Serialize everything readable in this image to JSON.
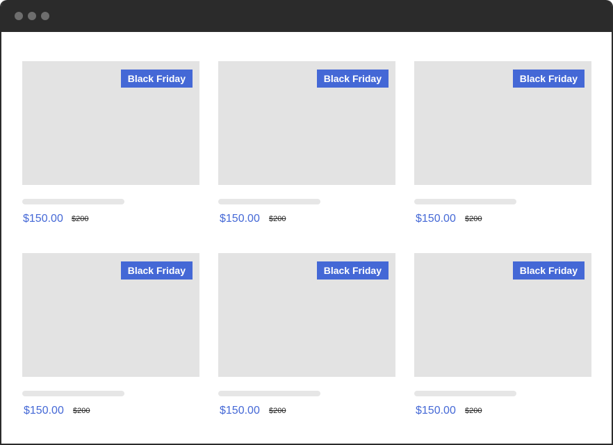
{
  "window": {
    "controls": [
      "close",
      "minimize",
      "maximize"
    ]
  },
  "accent_color": "#4468d6",
  "products": [
    {
      "badge": "Black Friday",
      "price": "$150.00",
      "old_price": "$200"
    },
    {
      "badge": "Black Friday",
      "price": "$150.00",
      "old_price": "$200"
    },
    {
      "badge": "Black Friday",
      "price": "$150.00",
      "old_price": "$200"
    },
    {
      "badge": "Black Friday",
      "price": "$150.00",
      "old_price": "$200"
    },
    {
      "badge": "Black Friday",
      "price": "$150.00",
      "old_price": "$200"
    },
    {
      "badge": "Black Friday",
      "price": "$150.00",
      "old_price": "$200"
    }
  ]
}
